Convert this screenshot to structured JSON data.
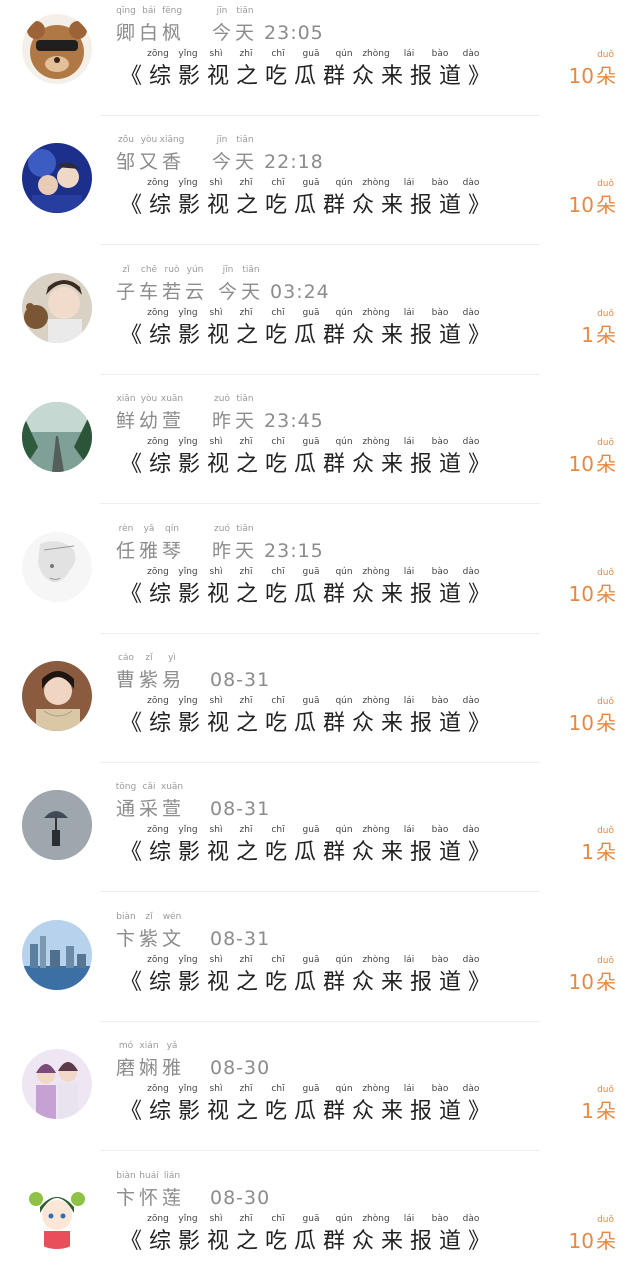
{
  "title": {
    "pinyin": [
      "zōng",
      "yǐng",
      "shì",
      "zhī",
      "chī",
      "guā",
      "qún",
      "zhòng",
      "lái",
      "bào",
      "dào"
    ],
    "text": "《综影视之吃瓜群众来报道》"
  },
  "unit": {
    "text": "朵",
    "pinyin": "duǒ"
  },
  "accent_color": "#e58a44",
  "entries": [
    {
      "name": "卿白枫",
      "name_pinyin": [
        "qīng",
        "bái",
        "fēng"
      ],
      "day": "今天",
      "day_pinyin": [
        "jīn",
        "tiān"
      ],
      "time": "23:05",
      "count": "10",
      "avatar_icon": "bear-sunglasses-avatar"
    },
    {
      "name": "邹又香",
      "name_pinyin": [
        "zōu",
        "yòu",
        "xiāng"
      ],
      "day": "今天",
      "day_pinyin": [
        "jīn",
        "tiān"
      ],
      "time": "22:18",
      "count": "10",
      "avatar_icon": "blue-couple-avatar"
    },
    {
      "name": "子车若云",
      "name_pinyin": [
        "zǐ",
        "chē",
        "ruò",
        "yún"
      ],
      "day": "今天",
      "day_pinyin": [
        "jīn",
        "tiān"
      ],
      "time": "03:24",
      "count": "1",
      "avatar_icon": "boy-with-bear-avatar"
    },
    {
      "name": "鲜幼萱",
      "name_pinyin": [
        "xiān",
        "yòu",
        "xuān"
      ],
      "day": "昨天",
      "day_pinyin": [
        "zuó",
        "tiān"
      ],
      "time": "23:45",
      "count": "10",
      "avatar_icon": "forest-road-avatar"
    },
    {
      "name": "任雅琴",
      "name_pinyin": [
        "rèn",
        "yǎ",
        "qín"
      ],
      "day": "昨天",
      "day_pinyin": [
        "zuó",
        "tiān"
      ],
      "time": "23:15",
      "count": "10",
      "avatar_icon": "sketch-portrait-avatar"
    },
    {
      "name": "曹紫易",
      "name_pinyin": [
        "cáo",
        "zǐ",
        "yì"
      ],
      "day": "",
      "day_pinyin": [],
      "time": "08-31",
      "count": "10",
      "avatar_icon": "woman-portrait-avatar"
    },
    {
      "name": "通采萱",
      "name_pinyin": [
        "tōng",
        "cǎi",
        "xuān"
      ],
      "day": "",
      "day_pinyin": [],
      "time": "08-31",
      "count": "1",
      "avatar_icon": "rain-umbrella-avatar"
    },
    {
      "name": "卞紫文",
      "name_pinyin": [
        "biàn",
        "zǐ",
        "wén"
      ],
      "day": "",
      "day_pinyin": [],
      "time": "08-31",
      "count": "10",
      "avatar_icon": "city-skyline-avatar"
    },
    {
      "name": "磨娴雅",
      "name_pinyin": [
        "mó",
        "xián",
        "yǎ"
      ],
      "day": "",
      "day_pinyin": [],
      "time": "08-30",
      "count": "1",
      "avatar_icon": "two-girls-avatar"
    },
    {
      "name": "卞怀莲",
      "name_pinyin": [
        "biàn",
        "huái",
        "lián"
      ],
      "day": "",
      "day_pinyin": [],
      "time": "08-30",
      "count": "10",
      "avatar_icon": "anime-girl-avatar"
    }
  ]
}
